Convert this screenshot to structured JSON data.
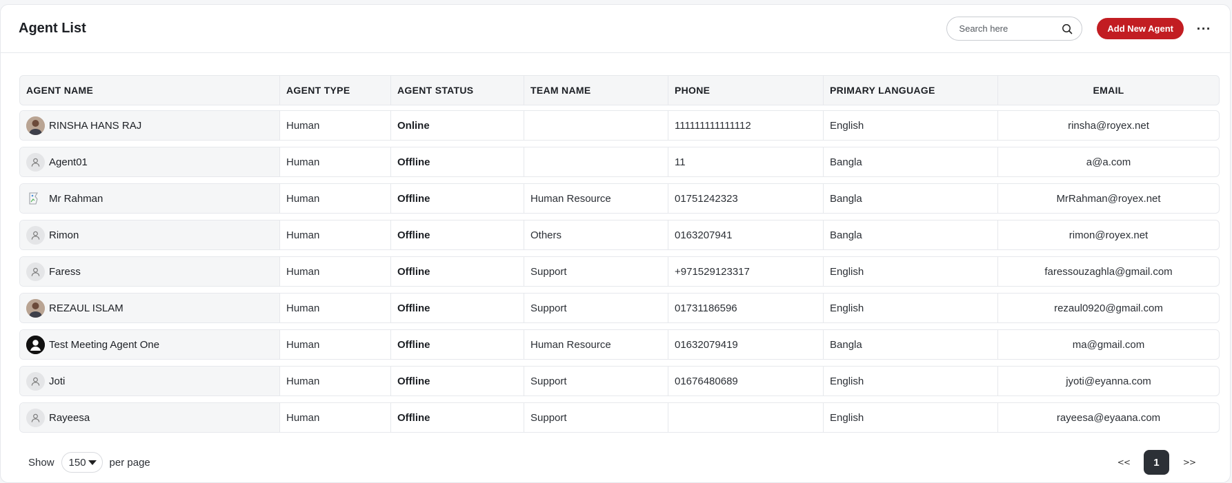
{
  "header": {
    "title": "Agent List",
    "search_placeholder": "Search here",
    "add_button_label": "Add New Agent",
    "more_label": "···"
  },
  "table": {
    "columns": [
      "AGENT NAME",
      "AGENT TYPE",
      "AGENT STATUS",
      "TEAM NAME",
      "PHONE",
      "PRIMARY LANGUAGE",
      "EMAIL"
    ],
    "rows": [
      {
        "name": "RINSHA HANS RAJ",
        "avatar": "photo-avatar",
        "type": "Human",
        "status": "Online",
        "team": "",
        "phone": "111111111111112",
        "language": "English",
        "email": "rinsha@royex.net"
      },
      {
        "name": "Agent01",
        "avatar": "default-avatar",
        "type": "Human",
        "status": "Offline",
        "team": "",
        "phone": "11",
        "language": "Bangla",
        "email": "a@a.com"
      },
      {
        "name": "Mr Rahman",
        "avatar": "broken-image-avatar",
        "type": "Human",
        "status": "Offline",
        "team": "Human Resource",
        "phone": "01751242323",
        "language": "Bangla",
        "email": "MrRahman@royex.net"
      },
      {
        "name": "Rimon",
        "avatar": "default-avatar",
        "type": "Human",
        "status": "Offline",
        "team": "Others",
        "phone": "0163207941",
        "language": "Bangla",
        "email": "rimon@royex.net"
      },
      {
        "name": "Faress",
        "avatar": "default-avatar",
        "type": "Human",
        "status": "Offline",
        "team": "Support",
        "phone": "+971529123317",
        "language": "English",
        "email": "faressouzaghla@gmail.com"
      },
      {
        "name": "REZAUL ISLAM",
        "avatar": "photo-avatar",
        "type": "Human",
        "status": "Offline",
        "team": "Support",
        "phone": "01731186596",
        "language": "English",
        "email": "rezaul0920@gmail.com"
      },
      {
        "name": "Test Meeting Agent One",
        "avatar": "black-user-avatar",
        "type": "Human",
        "status": "Offline",
        "team": "Human Resource",
        "phone": "01632079419",
        "language": "Bangla",
        "email": "ma@gmail.com"
      },
      {
        "name": "Joti",
        "avatar": "default-avatar",
        "type": "Human",
        "status": "Offline",
        "team": "Support",
        "phone": "01676480689",
        "language": "English",
        "email": "jyoti@eyanna.com"
      },
      {
        "name": "Rayeesa",
        "avatar": "default-avatar",
        "type": "Human",
        "status": "Offline",
        "team": "Support",
        "phone": "",
        "language": "English",
        "email": "rayeesa@eyaana.com"
      }
    ]
  },
  "footer": {
    "show_label": "Show",
    "per_page_value": "150",
    "per_page_label": "per page",
    "prev_label": "<<",
    "current_page": "1",
    "next_label": ">>"
  },
  "colors": {
    "accent": "#c21d22",
    "pager_active": "#2c3036"
  }
}
